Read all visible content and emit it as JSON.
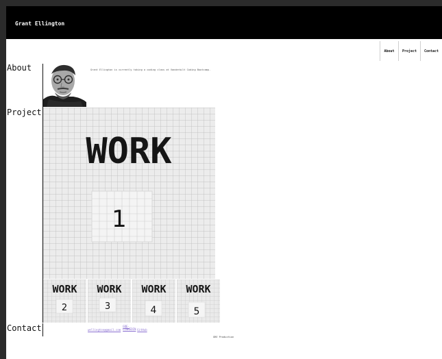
{
  "header": {
    "brand": "Grant Ellington"
  },
  "nav": [
    {
      "label": "About"
    },
    {
      "label": "Project"
    },
    {
      "label": "Contact"
    }
  ],
  "about": {
    "heading": "About",
    "bio": "Grant Ellington is currently taking a coding class at Vanderbilt Coding Bootcamp."
  },
  "project": {
    "heading": "Project",
    "hero": {
      "title": "WORK",
      "number": "1"
    },
    "thumbnails": [
      {
        "title": "WORK",
        "number": "2"
      },
      {
        "title": "WORK",
        "number": "3"
      },
      {
        "title": "WORK",
        "number": "4"
      },
      {
        "title": "WORK",
        "number": "5"
      }
    ]
  },
  "contact": {
    "heading": "Contact",
    "email": "wellington@gmail.com",
    "linkedin": "GRE-LINKEDIN",
    "github": "GitHub"
  },
  "footer": {
    "text": "GRE Production"
  }
}
